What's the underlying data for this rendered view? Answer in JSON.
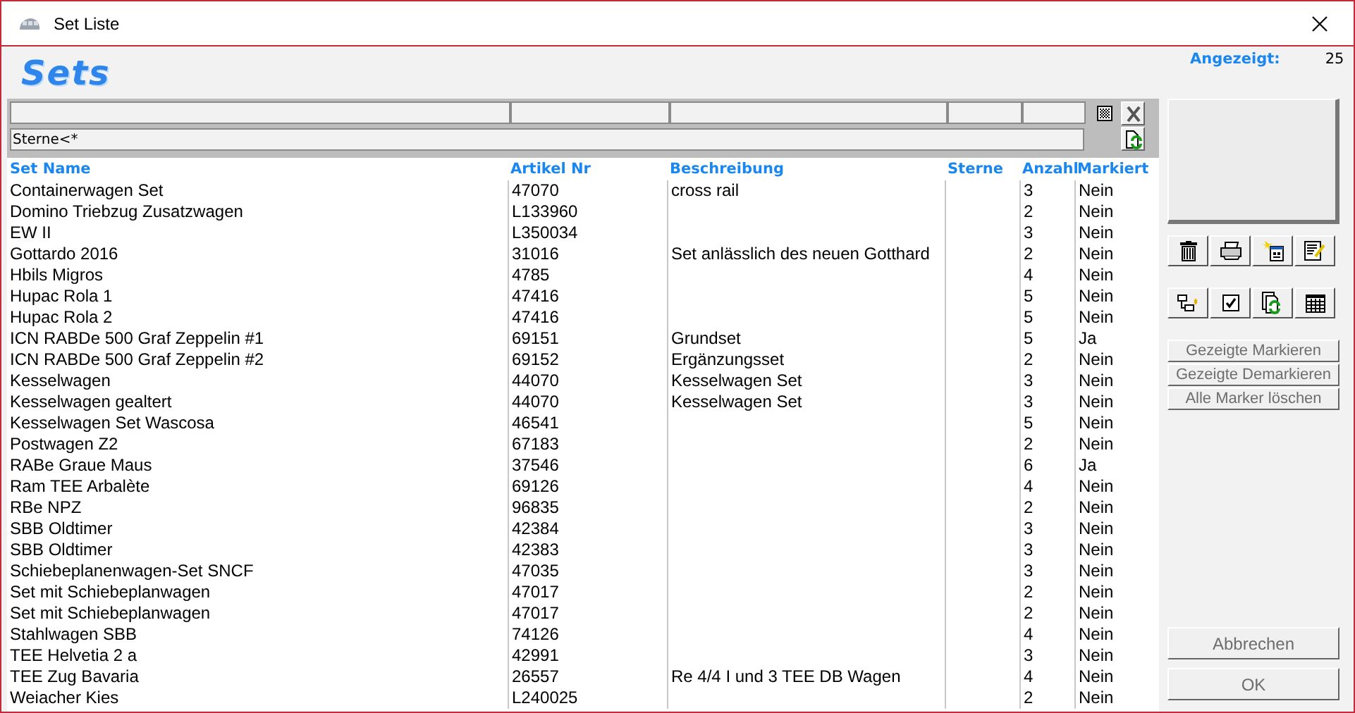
{
  "window": {
    "title": "Set Liste"
  },
  "heading": "Sets",
  "count": {
    "label": "Angezeigt:",
    "value": "25"
  },
  "filter": {
    "value": "Sterne<*"
  },
  "table": {
    "columns": [
      "Set Name",
      "Artikel Nr",
      "Beschreibung",
      "Sterne",
      "Anzahl",
      "Markiert"
    ],
    "rows": [
      [
        "Containerwagen Set",
        "47070",
        "cross rail",
        "",
        "3",
        "Nein"
      ],
      [
        "Domino Triebzug Zusatzwagen",
        "L133960",
        "",
        "",
        "2",
        "Nein"
      ],
      [
        "EW II",
        "L350034",
        "",
        "",
        "3",
        "Nein"
      ],
      [
        "Gottardo 2016",
        "31016",
        "Set anlässlich des neuen Gotthard",
        "",
        "2",
        "Nein"
      ],
      [
        "Hbils Migros",
        "4785",
        "",
        "",
        "4",
        "Nein"
      ],
      [
        "Hupac Rola 1",
        "47416",
        "",
        "",
        "5",
        "Nein"
      ],
      [
        "Hupac Rola 2",
        "47416",
        "",
        "",
        "5",
        "Nein"
      ],
      [
        "ICN RABDe 500  Graf Zeppelin #1",
        "69151",
        "Grundset",
        "",
        "5",
        "Ja"
      ],
      [
        "ICN RABDe 500  Graf Zeppelin #2",
        "69152",
        "Ergänzungsset",
        "",
        "2",
        "Nein"
      ],
      [
        "Kesselwagen",
        "44070",
        "Kesselwagen Set",
        "",
        "3",
        "Nein"
      ],
      [
        "Kesselwagen gealtert",
        "44070",
        "Kesselwagen Set",
        "",
        "3",
        "Nein"
      ],
      [
        "Kesselwagen Set Wascosa",
        "46541",
        "",
        "",
        "5",
        "Nein"
      ],
      [
        "Postwagen Z2",
        "67183",
        "",
        "",
        "2",
        "Nein"
      ],
      [
        "RABe Graue Maus",
        "37546",
        "",
        "",
        "6",
        "Ja"
      ],
      [
        "Ram TEE Arbalète",
        "69126",
        "",
        "",
        "4",
        "Nein"
      ],
      [
        "RBe NPZ",
        "96835",
        "",
        "",
        "2",
        "Nein"
      ],
      [
        "SBB Oldtimer",
        "42384",
        "",
        "",
        "3",
        "Nein"
      ],
      [
        "SBB Oldtimer",
        "42383",
        "",
        "",
        "3",
        "Nein"
      ],
      [
        "Schiebeplanenwagen-Set SNCF",
        "47035",
        "",
        "",
        "3",
        "Nein"
      ],
      [
        "Set mit Schiebeplanwagen",
        "47017",
        "",
        "",
        "2",
        "Nein"
      ],
      [
        "Set mit Schiebeplanwagen",
        "47017",
        "",
        "",
        "2",
        "Nein"
      ],
      [
        "Stahlwagen SBB",
        "74126",
        "",
        "",
        "4",
        "Nein"
      ],
      [
        "TEE Helvetia 2 a",
        "42991",
        "",
        "",
        "3",
        "Nein"
      ],
      [
        "TEE Zug Bavaria",
        "26557",
        "Re 4/4 I und 3 TEE DB Wagen",
        "",
        "4",
        "Nein"
      ],
      [
        "Weiacher Kies",
        "L240025",
        "",
        "",
        "2",
        "Nein"
      ]
    ]
  },
  "marker_buttons": [
    {
      "label": "Gezeigte Markieren",
      "disabled": true
    },
    {
      "label": "Gezeigte Demarkieren",
      "disabled": true
    },
    {
      "label": "Alle Marker löschen",
      "disabled": true
    }
  ],
  "dialog_buttons": [
    {
      "label": "Abbrechen",
      "disabled": true
    },
    {
      "label": "OK",
      "disabled": true
    }
  ]
}
